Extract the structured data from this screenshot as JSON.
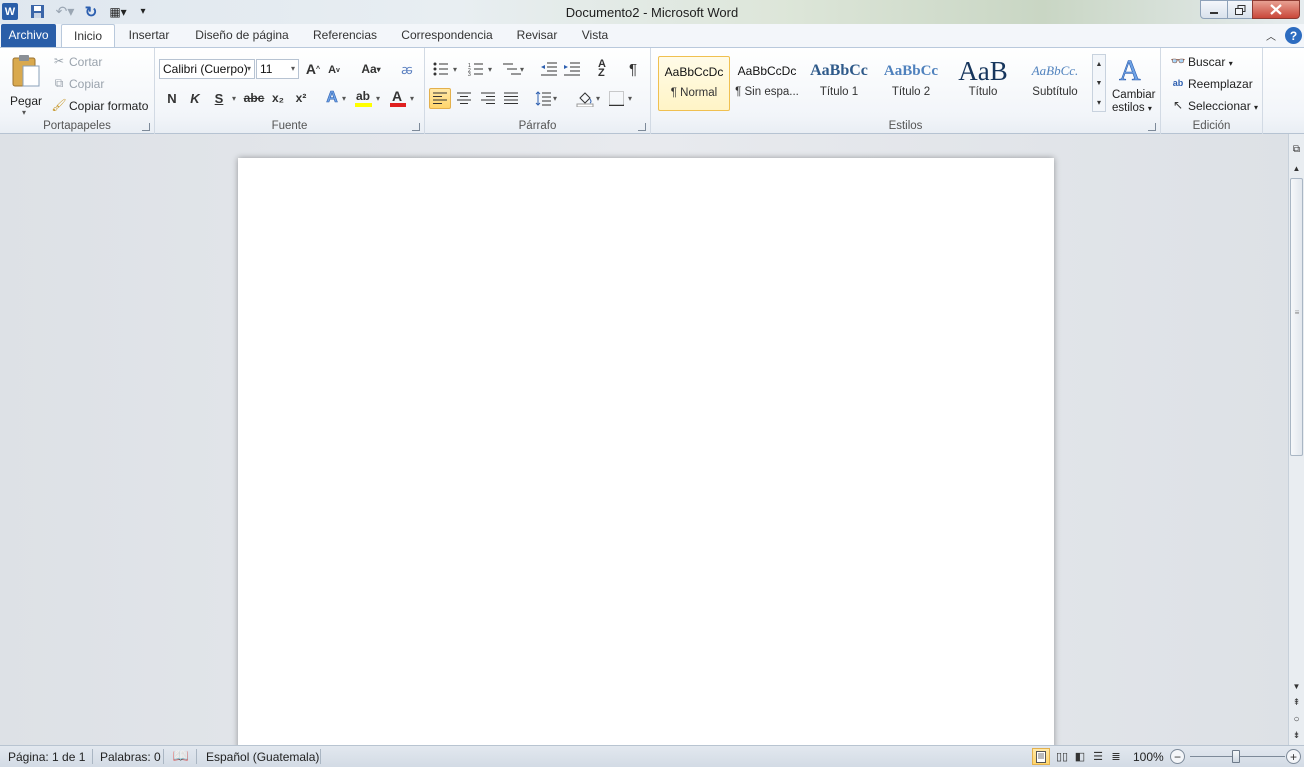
{
  "window": {
    "title": "Documento2  -  Microsoft Word",
    "controls": {
      "minimize": "minimize",
      "restore": "restore",
      "close": "close"
    }
  },
  "qat": {
    "icons": [
      "word-icon",
      "save-icon",
      "undo-icon",
      "redo-icon",
      "customize-qat-icon"
    ]
  },
  "tabs": [
    {
      "label": "Archivo"
    },
    {
      "label": "Inicio"
    },
    {
      "label": "Insertar"
    },
    {
      "label": "Diseño de página"
    },
    {
      "label": "Referencias"
    },
    {
      "label": "Correspondencia"
    },
    {
      "label": "Revisar"
    },
    {
      "label": "Vista"
    }
  ],
  "clipboard": {
    "paste_label": "Pegar",
    "cut_label": "Cortar",
    "copy_label": "Copiar",
    "format_painter_label": "Copiar formato",
    "group_label": "Portapapeles"
  },
  "font": {
    "font_name": "Calibri (Cuerpo)",
    "font_size": "11",
    "group_label": "Fuente",
    "bold": "N",
    "italic": "K",
    "underline": "S",
    "strike": "abc",
    "subscript": "x₂",
    "superscript": "x²",
    "change_case": "Aa",
    "grow": "A",
    "shrink": "A",
    "text_effects": "A",
    "font_color": "A"
  },
  "paragraph": {
    "group_label": "Párrafo",
    "pilcrow": "¶"
  },
  "styles": {
    "group_label": "Estilos",
    "items": [
      {
        "preview": "AaBbCcDc",
        "name": "¶ Normal"
      },
      {
        "preview": "AaBbCcDc",
        "name": "¶ Sin espa..."
      },
      {
        "preview": "AaBbCc",
        "name": "Título 1"
      },
      {
        "preview": "AaBbCc",
        "name": "Título 2"
      },
      {
        "preview": "AaB",
        "name": "Título"
      },
      {
        "preview": "AaBbCc.",
        "name": "Subtítulo"
      }
    ],
    "change_styles_line1": "Cambiar",
    "change_styles_line2": "estilos"
  },
  "editing": {
    "group_label": "Edición",
    "find_label": "Buscar",
    "replace_label": "Reemplazar",
    "select_label": "Seleccionar"
  },
  "status": {
    "page": "Página: 1 de 1",
    "words": "Palabras: 0",
    "language": "Español (Guatemala)",
    "zoom": "100%"
  },
  "colors": {
    "accent": "#2a5ea8",
    "highlight": "#ffff00",
    "font_color": "#e02020"
  }
}
